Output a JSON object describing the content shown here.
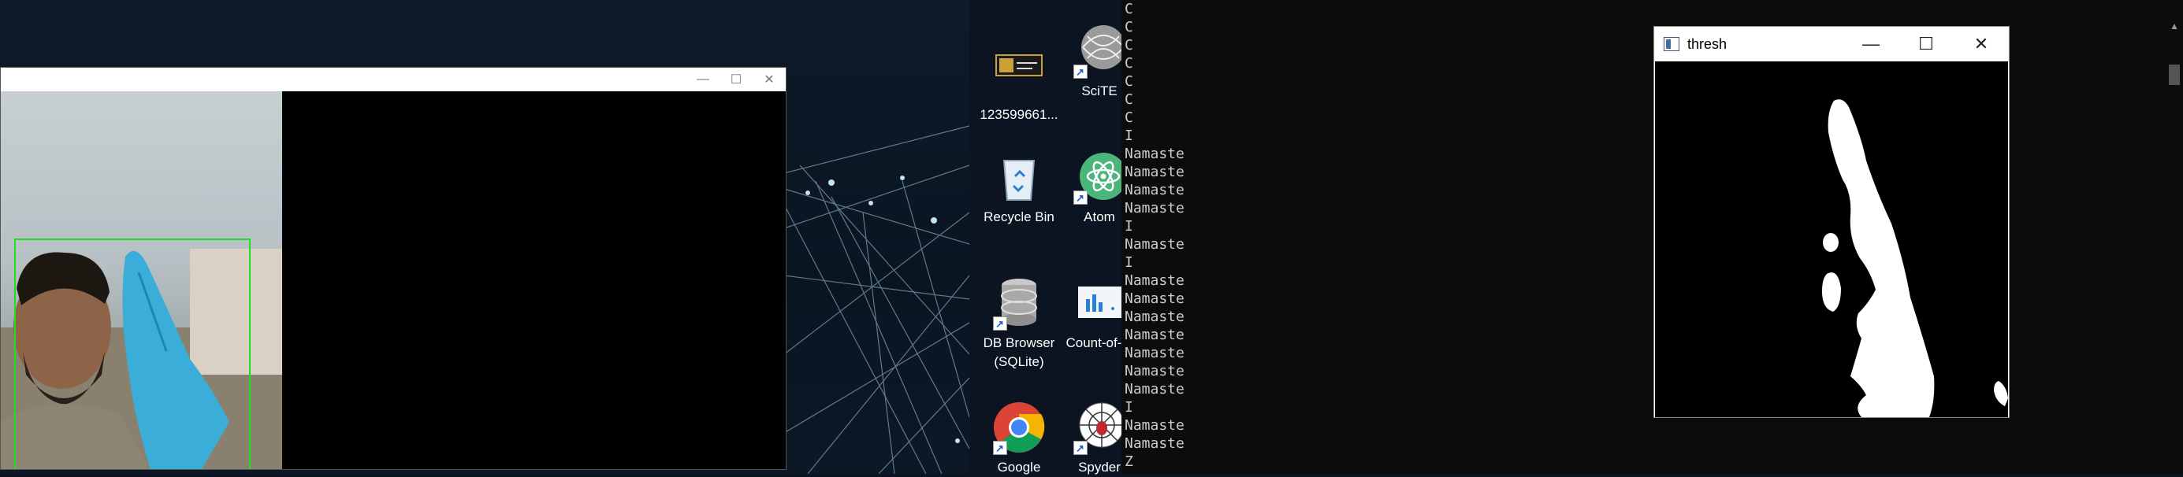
{
  "camera_window": {
    "controls": {
      "minimize": "—",
      "maximize": "☐",
      "close": "✕"
    }
  },
  "desktop_icons": [
    {
      "label": "123599661...",
      "icon": "image-thumbnail-icon"
    },
    {
      "label": "SciTE",
      "icon": "scite-icon"
    },
    {
      "label": "Recycle Bin",
      "icon": "recycle-bin-icon"
    },
    {
      "label": "Atom",
      "icon": "atom-icon"
    },
    {
      "label": "DB Browser (SQLite)",
      "icon": "database-icon"
    },
    {
      "label": "Count-of-...",
      "icon": "chart-file-icon"
    },
    {
      "label": "Google",
      "icon": "chrome-icon"
    },
    {
      "label": "Spyder",
      "icon": "spyder-icon"
    }
  ],
  "console": {
    "lines": [
      "C",
      "C",
      "C",
      "C",
      "C",
      "C",
      "C",
      "I",
      "Namaste",
      "Namaste",
      "Namaste",
      "Namaste",
      "I",
      "Namaste",
      "I",
      "Namaste",
      "Namaste",
      "Namaste",
      "Namaste",
      "Namaste",
      "Namaste",
      "Namaste",
      "I",
      "Namaste",
      "Namaste",
      "Z"
    ]
  },
  "thresh_window": {
    "title": "thresh",
    "controls": {
      "minimize": "—",
      "maximize": "☐",
      "close": "✕"
    }
  },
  "colors": {
    "detection_box": "#22dd22",
    "console_text": "#cccccc",
    "console_bg": "#0c0c0c",
    "glove": "#3aaed8"
  }
}
